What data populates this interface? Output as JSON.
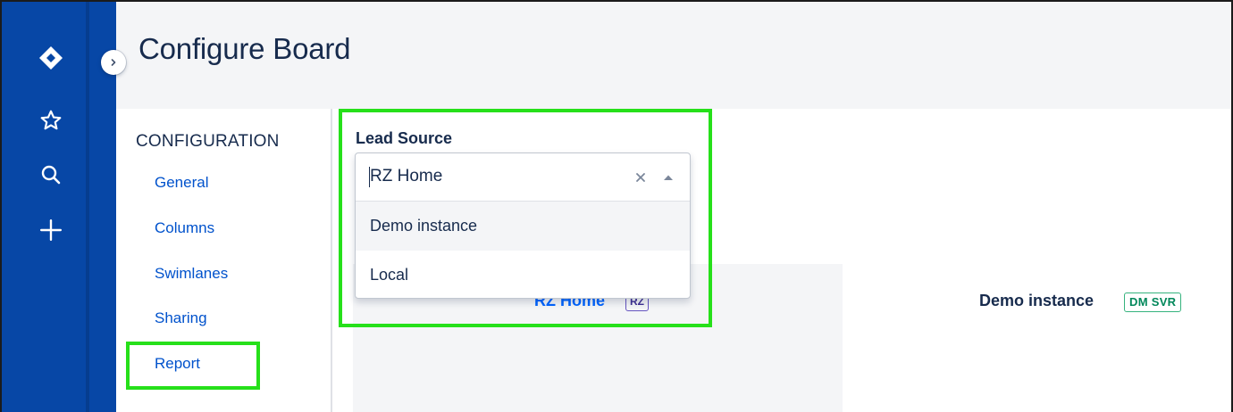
{
  "header": {
    "title": "Configure Board"
  },
  "global_nav": {
    "icons": [
      "jira-logo-icon",
      "star-icon",
      "search-icon",
      "plus-icon"
    ],
    "colors": {
      "background": "#0747a6"
    }
  },
  "config_nav": {
    "heading": "CONFIGURATION",
    "items": [
      {
        "label": "General"
      },
      {
        "label": "Columns"
      },
      {
        "label": "Swimlanes"
      },
      {
        "label": "Sharing"
      },
      {
        "label": "Report"
      }
    ]
  },
  "lead_source": {
    "label": "Lead Source",
    "selected_value": "RZ Home",
    "options": [
      {
        "label": "Demo instance"
      },
      {
        "label": "Local"
      }
    ]
  },
  "board_preview": {
    "label": "RZ Home",
    "badge": "RZ"
  },
  "instance": {
    "name": "Demo instance",
    "badge": "DM SVR"
  },
  "colors": {
    "highlight": "#26e01a",
    "link": "#0052cc",
    "badge_green": "#36b37e",
    "badge_purple": "#6554c0"
  }
}
